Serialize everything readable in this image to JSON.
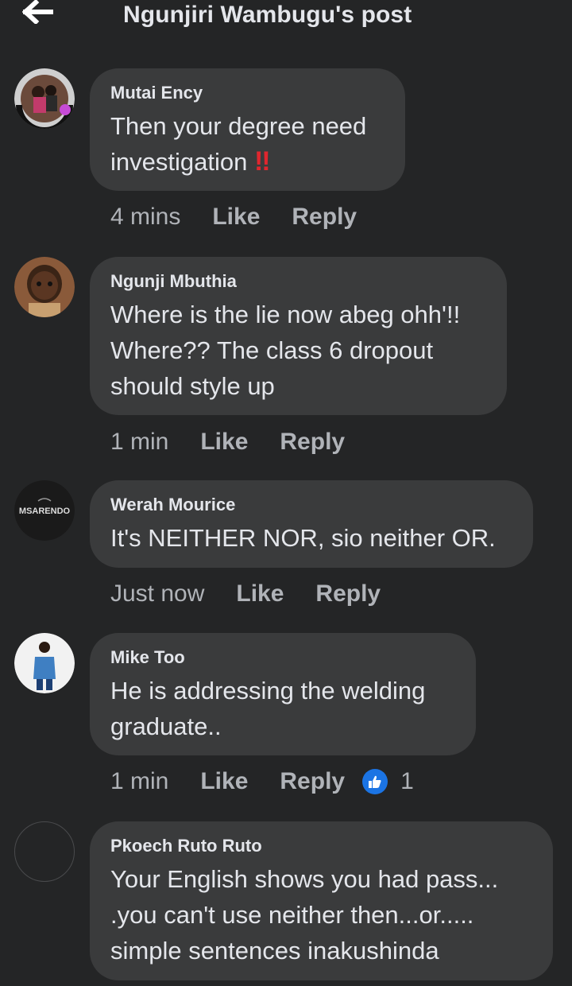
{
  "header": {
    "title": "Ngunjiri Wambugu's post"
  },
  "comments": [
    {
      "author": "Mutai Ency",
      "lines": [
        "Then your degree need",
        "investigation "
      ],
      "emoji": "‼",
      "time": "4 mins",
      "like": "Like",
      "reply": "Reply"
    },
    {
      "author": "Ngunji Mbuthia",
      "lines": [
        "Where is the lie now abeg ohh'!!",
        "Where?? The class 6 dropout",
        "should style up"
      ],
      "time": "1 min",
      "like": "Like",
      "reply": "Reply"
    },
    {
      "author": "Werah Mourice",
      "lines": [
        "It's NEITHER NOR, sio neither  OR."
      ],
      "avatar_text": "MSARENDO",
      "time": "Just now",
      "like": "Like",
      "reply": "Reply"
    },
    {
      "author": "Mike Too",
      "lines": [
        "He is addressing the welding",
        "graduate.."
      ],
      "time": "1 min",
      "like": "Like",
      "reply": "Reply",
      "reaction_count": "1"
    },
    {
      "author": "Pkoech Ruto Ruto",
      "lines": [
        "Your English shows you had pass...",
        ".you can't use neither then...or.....",
        "simple sentences inakushinda"
      ]
    }
  ],
  "colors": {
    "background": "#242526",
    "bubble": "#3a3b3c",
    "text": "#e4e6eb",
    "muted": "#b0b3b8",
    "like_blue": "#1b74e4",
    "emoji_red": "#e0262e"
  },
  "icons": {
    "back": "arrow-left-icon",
    "reaction": "thumbs-up-icon"
  }
}
